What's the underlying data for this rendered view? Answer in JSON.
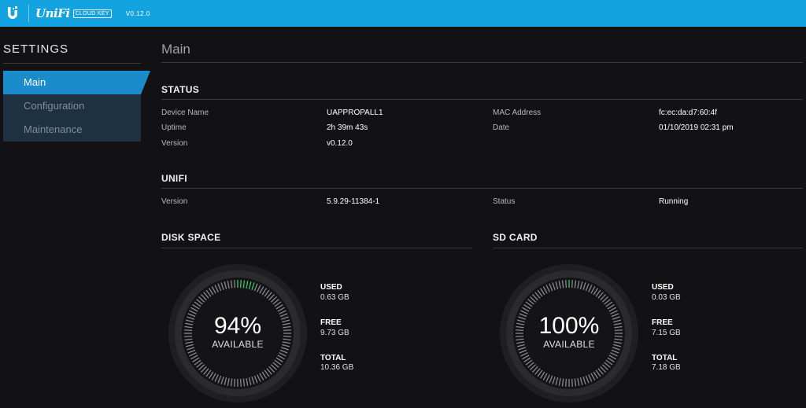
{
  "topbar": {
    "brand": "UniFi",
    "badge": "CLOUD KEY",
    "version": "V0.12.0",
    "color": "#12a3e0"
  },
  "sidebar": {
    "title": "SETTINGS",
    "items": [
      {
        "label": "Main",
        "active": true
      },
      {
        "label": "Configuration",
        "active": false
      },
      {
        "label": "Maintenance",
        "active": false
      }
    ]
  },
  "main": {
    "title": "Main",
    "status": {
      "heading": "STATUS",
      "device_name_label": "Device Name",
      "device_name": "UAPPROPALL1",
      "uptime_label": "Uptime",
      "uptime": "2h 39m 43s",
      "version_label": "Version",
      "version": "v0.12.0",
      "mac_label": "MAC Address",
      "mac": "fc:ec:da:d7:60:4f",
      "date_label": "Date",
      "date": "01/10/2019 02:31 pm"
    },
    "unifi": {
      "heading": "UNIFI",
      "version_label": "Version",
      "version": "5.9.29-11384-1",
      "status_label": "Status",
      "status": "Running"
    },
    "disk": {
      "heading": "DISK SPACE",
      "percent": "94%",
      "available_label": "AVAILABLE",
      "used_fraction": 0.06,
      "used_label": "USED",
      "used": "0.63 GB",
      "free_label": "FREE",
      "free": "9.73 GB",
      "total_label": "TOTAL",
      "total": "10.36 GB"
    },
    "sdcard": {
      "heading": "SD CARD",
      "percent": "100%",
      "available_label": "AVAILABLE",
      "used_fraction": 0.004,
      "used_label": "USED",
      "used": "0.03 GB",
      "free_label": "FREE",
      "free": "7.15 GB",
      "total_label": "TOTAL",
      "total": "7.18 GB"
    }
  },
  "colors": {
    "accent": "#1a8ccc",
    "used_tick": "#3ec46d",
    "free_tick": "#8a8a8c"
  }
}
